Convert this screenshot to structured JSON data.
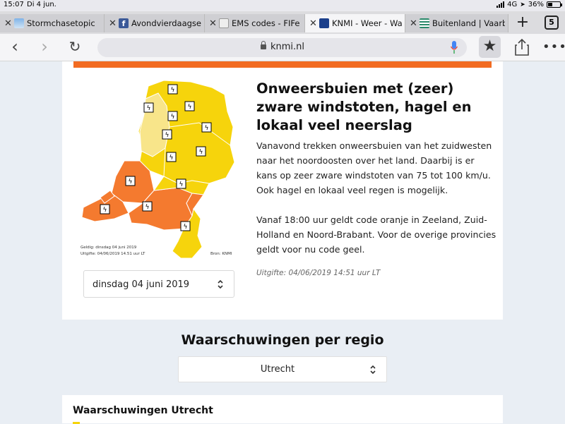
{
  "status_bar": {
    "time": "15:07",
    "date": "Di 4 jun.",
    "network": "4G",
    "battery": "36%"
  },
  "tabs": [
    {
      "label": "Stormchasetopic",
      "favicon": "storm-icon",
      "active": false
    },
    {
      "label": "Avondvierdaagse",
      "favicon": "facebook-icon",
      "active": false
    },
    {
      "label": "EMS codes - FIFe",
      "favicon": "cat-icon",
      "active": false
    },
    {
      "label": "KNMI - Weer - Waa",
      "favicon": "knmi-icon",
      "active": true
    },
    {
      "label": "Buitenland | Vaarb",
      "favicon": "waves-icon",
      "active": false
    }
  ],
  "tab_count": "5",
  "address_bar": {
    "url": "knmi.nl"
  },
  "warning": {
    "title": "Onweersbuien met (zeer) zware windstoten, hagel en lokaal veel neerslag",
    "paragraph1": "Vanavond trekken onweersbuien van het zuidwesten naar het noordoosten over het land. Daarbij is er kans op zeer zware windstoten van 75 tot 100 km/u. Ook hagel en lokaal veel regen is mogelijk.",
    "paragraph2": "Vanaf 18:00 uur geldt code oranje in Zeeland, Zuid-Holland en Noord-Brabant. Voor de overige provincies geldt voor nu code geel.",
    "issued": "Uitgifte: 04/06/2019 14:51 uur LT"
  },
  "map": {
    "valid_line": "Geldig: dinsdag 04 juni 2019",
    "issued_line": "Uitgifte: 04/06/2019 14.51 uur LT",
    "source_line": "Bron: KNMI",
    "colors": {
      "yellow": "#f6d40c",
      "light_yellow": "#f8e58a",
      "orange": "#f47a2f"
    }
  },
  "date_select": {
    "value": "dinsdag 04 juni 2019"
  },
  "region_section": {
    "heading": "Waarschuwingen per regio",
    "selected_region": "Utrecht"
  },
  "region_card": {
    "heading": "Waarschuwingen Utrecht"
  }
}
